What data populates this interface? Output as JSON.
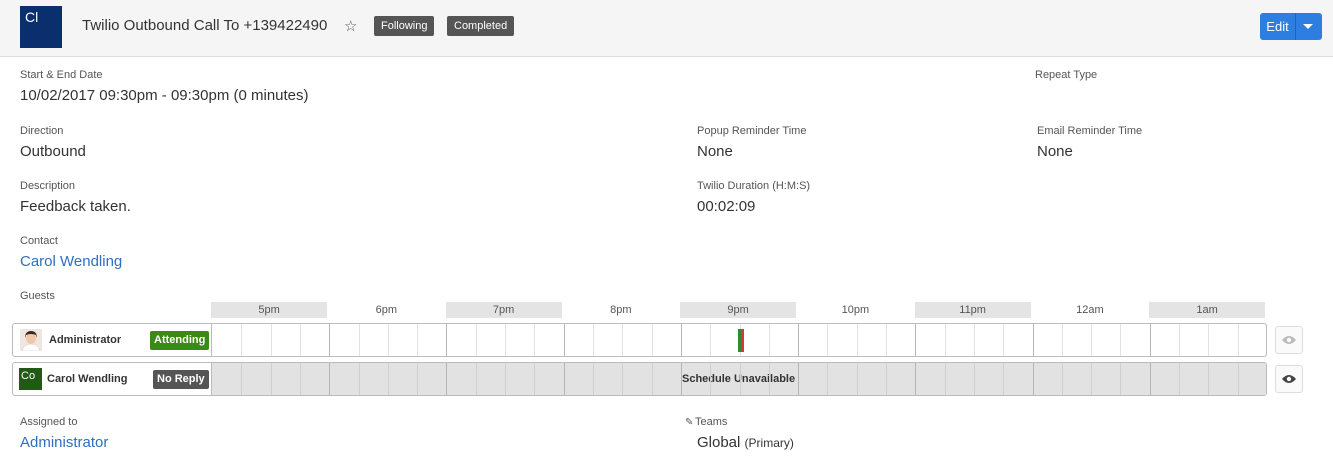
{
  "header": {
    "avatar_initials": "Cl",
    "title": "Twilio Outbound Call To +139422490",
    "star_icon": "star-outline-icon",
    "badges": [
      "Following",
      "Completed"
    ],
    "edit_label": "Edit"
  },
  "fields": {
    "start_end": {
      "label": "Start & End Date",
      "value": "10/02/2017 09:30pm - 09:30pm (0 minutes)"
    },
    "repeat_type": {
      "label": "Repeat Type",
      "value": ""
    },
    "direction": {
      "label": "Direction",
      "value": "Outbound"
    },
    "popup_reminder": {
      "label": "Popup Reminder Time",
      "value": "None"
    },
    "email_reminder": {
      "label": "Email Reminder Time",
      "value": "None"
    },
    "description": {
      "label": "Description",
      "value": "Feedback taken."
    },
    "twilio_duration": {
      "label": "Twilio Duration (H:M:S)",
      "value": "00:02:09"
    },
    "contact": {
      "label": "Contact",
      "value": "Carol Wendling"
    },
    "guests": {
      "label": "Guests"
    },
    "assigned_to": {
      "label": "Assigned to",
      "value": "Administrator"
    },
    "teams": {
      "label": "Teams",
      "value": "Global",
      "suffix": "(Primary)"
    }
  },
  "timeline": {
    "hours": [
      "5pm",
      "6pm",
      "7pm",
      "8pm",
      "9pm",
      "10pm",
      "11pm",
      "12am",
      "1am"
    ],
    "guests": [
      {
        "name": "Administrator",
        "status": "Attending",
        "status_color": "#3a8a13",
        "avatar": "user-photo"
      },
      {
        "name": "Carol Wendling",
        "status": "No Reply",
        "status_color": "#555555",
        "avatar_initials": "Co",
        "unavailable_text": "Schedule Unavailable"
      }
    ],
    "event_marker_colors": [
      "#2e8b2e",
      "#d43a2f"
    ]
  },
  "icons": {
    "eye": "eye-icon",
    "pencil": "pencil-icon"
  }
}
